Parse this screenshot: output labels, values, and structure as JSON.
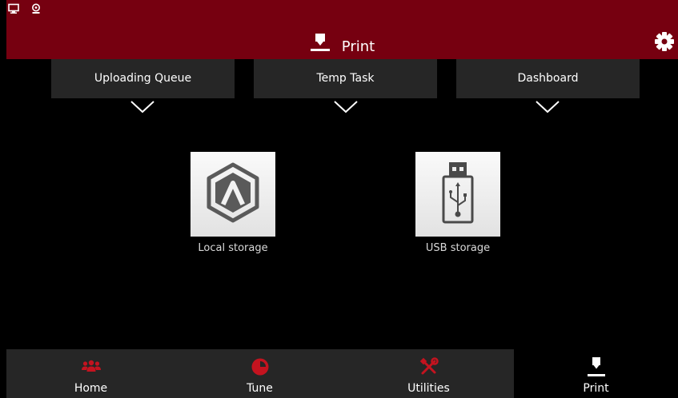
{
  "header": {
    "title": "Print",
    "icons": [
      "monitor-icon",
      "webcam-icon",
      "print-nozzle-icon",
      "gear-icon"
    ],
    "accent_color": "#760010"
  },
  "tabs": [
    {
      "label": "Uploading Queue"
    },
    {
      "label": "Temp Task"
    },
    {
      "label": "Dashboard"
    }
  ],
  "storage": [
    {
      "label": "Local storage",
      "icon": "local-storage-icon"
    },
    {
      "label": "USB storage",
      "icon": "usb-drive-icon"
    }
  ],
  "nav": [
    {
      "label": "Home",
      "icon": "users-icon",
      "color": "#c4131f"
    },
    {
      "label": "Tune",
      "icon": "pie-chart-icon",
      "color": "#c4131f"
    },
    {
      "label": "Utilities",
      "icon": "tools-icon",
      "color": "#c4131f"
    },
    {
      "label": "Print",
      "icon": "print-nozzle-icon",
      "color": "#ffffff",
      "active": true
    }
  ]
}
